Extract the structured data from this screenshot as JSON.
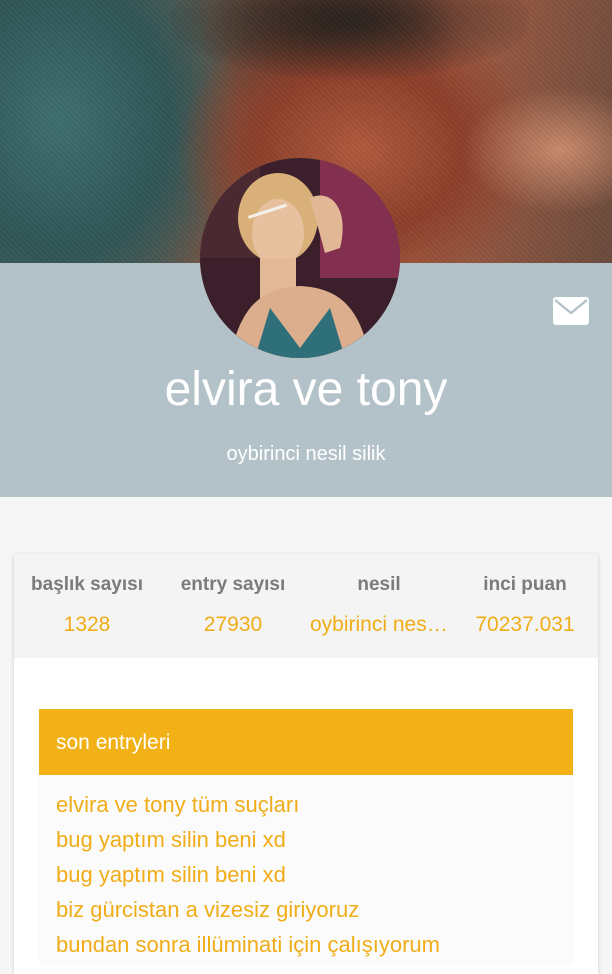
{
  "profile": {
    "name": "elvira ve tony",
    "generation": "oybirinci nesil silik"
  },
  "header": {
    "cover_image": "cover-photo",
    "avatar_image": "avatar-photo",
    "mail_icon": "mail-icon"
  },
  "stats": [
    {
      "label": "başlık sayısı",
      "value": "1328"
    },
    {
      "label": "entry sayısı",
      "value": "27930"
    },
    {
      "label": "nesil",
      "value": "oybirinci nesil silik"
    },
    {
      "label": "inci puan",
      "value": "70237.031"
    }
  ],
  "recent_entries": {
    "title": "son entryleri",
    "items": [
      "elvira ve tony tüm suçları",
      "bug yaptım silin beni xd",
      "bug yaptım silin beni xd",
      "biz gürcistan a vizesiz giriyoruz",
      "bundan sonra illüminati için çalışıyorum"
    ]
  },
  "colors": {
    "accent": "#f0ad18",
    "band": "#b3c2c8",
    "header_bar": "#f2b116"
  }
}
